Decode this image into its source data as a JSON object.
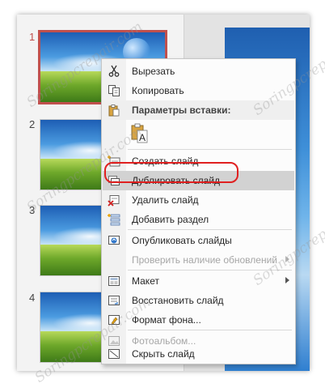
{
  "slides": [
    {
      "number": "1",
      "selected": true
    },
    {
      "number": "2",
      "selected": false
    },
    {
      "number": "3",
      "selected": false
    },
    {
      "number": "4",
      "selected": false
    }
  ],
  "context_menu": {
    "cut": "Вырезать",
    "copy": "Копировать",
    "paste_options_header": "Параметры вставки:",
    "new_slide": "Создать слайд",
    "duplicate_slide": "Дублировать слайд",
    "delete_slide": "Удалить слайд",
    "add_section": "Добавить раздел",
    "publish_slides": "Опубликовать слайды",
    "check_updates": "Проверить наличие обновлений",
    "layout": "Макет",
    "reset_slide": "Восстановить слайд",
    "format_background": "Формат фона...",
    "photo_album": "Фотоальбом...",
    "hide_slide": "Скрыть слайд",
    "hovered_item": "duplicate_slide"
  },
  "watermark": "Soringpcrepair.com",
  "colors": {
    "selection_border": "#c0504d",
    "highlight_ring": "#e02020",
    "hover_bg": "#d2d2d2"
  },
  "icons": {
    "cut": "scissors-icon",
    "copy": "copy-icon",
    "paste_text": "paste-keep-text-icon",
    "new_slide": "new-slide-icon",
    "duplicate": "duplicate-slide-icon",
    "delete": "delete-slide-icon",
    "section": "add-section-icon",
    "publish": "publish-slides-icon",
    "layout": "layout-icon",
    "reset": "reset-slide-icon",
    "format_bg": "format-background-icon",
    "album": "photo-album-icon",
    "hide": "hide-slide-icon"
  }
}
